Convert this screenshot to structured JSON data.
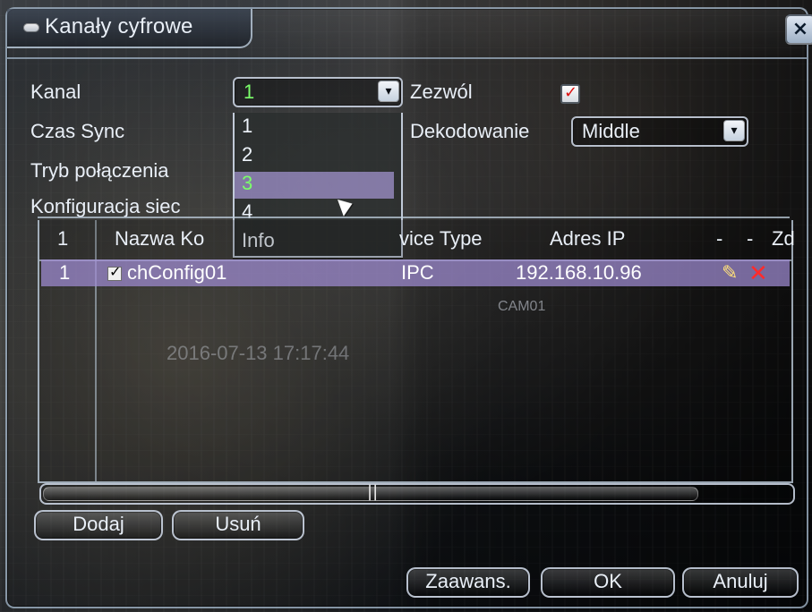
{
  "window": {
    "title": "Kanały cyfrowe",
    "close_label": "×"
  },
  "form": {
    "kanal_label": "Kanal",
    "kanal_value": "1",
    "zezwol_label": "Zezwól",
    "czas_sync_label": "Czas Sync",
    "dekodowanie_label": "Dekodowanie",
    "dekodowanie_value": "Middle",
    "tryb_polaczenia_label": "Tryb połączenia",
    "konfiguracja_label": "Konfiguracja siec"
  },
  "dropdown": {
    "options": [
      "1",
      "2",
      "3",
      "4",
      "Info"
    ]
  },
  "table": {
    "headers": [
      "1",
      "Nazwa Ko",
      "vice Type",
      "Adres IP",
      "-",
      "-",
      "Zd"
    ],
    "rows": [
      {
        "idx": "1",
        "name": "chConfig01",
        "type": "IPC",
        "ip": "192.168.10.96"
      }
    ]
  },
  "overlay": {
    "camera_label": "CAM01",
    "timestamp": "2016-07-13 17:17:44"
  },
  "buttons": {
    "dodaj": "Dodaj",
    "usun": "Usuń",
    "zaawans": "Zaawans.",
    "ok": "OK",
    "anuluj": "Anuluj"
  },
  "colors": {
    "highlight_row": "#a08cd2",
    "highlight_text_green": "#7cff6b",
    "check_red": "#dd1111"
  }
}
